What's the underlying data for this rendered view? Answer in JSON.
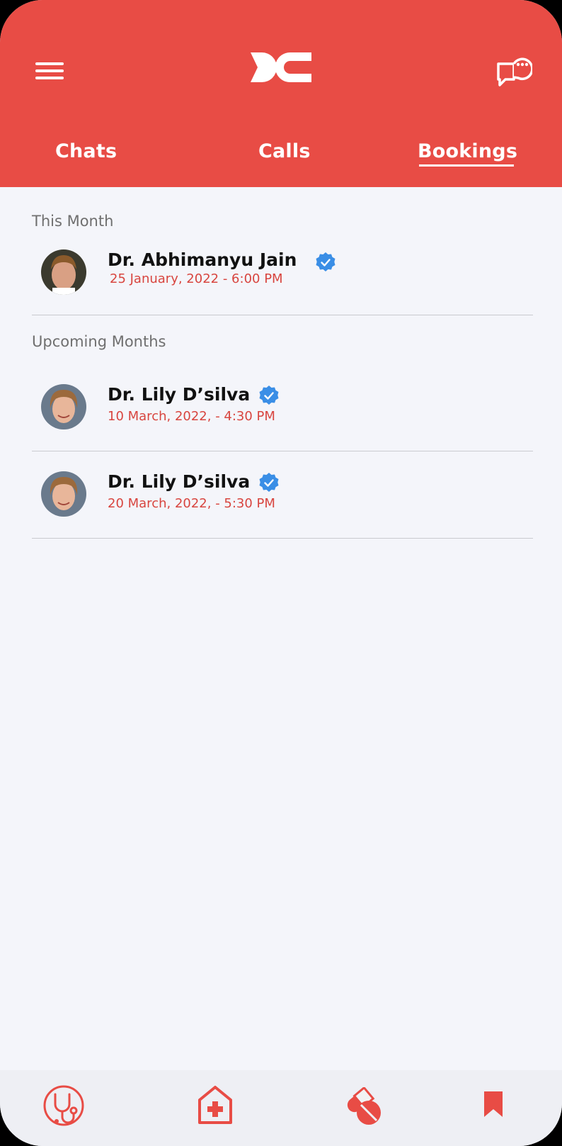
{
  "header": {
    "tabs": [
      {
        "label": "Chats",
        "active": false
      },
      {
        "label": "Calls",
        "active": false
      },
      {
        "label": "Bookings",
        "active": true
      }
    ]
  },
  "sections": [
    {
      "label": "This Month",
      "bookings": [
        {
          "name": "Dr. Abhimanyu Jain",
          "datetime": "25 January, 2022 - 6:00 PM",
          "verified": true
        }
      ]
    },
    {
      "label": "Upcoming Months",
      "bookings": [
        {
          "name": "Dr. Lily D’silva",
          "datetime": "10 March, 2022, - 4:30 PM",
          "verified": true
        },
        {
          "name": "Dr. Lily D’silva",
          "datetime": "20 March, 2022, - 5:30 PM",
          "verified": true
        }
      ]
    }
  ],
  "bottom_nav": {
    "items": [
      "stethoscope-icon",
      "hospital-icon",
      "pills-icon",
      "bookmark-icon"
    ]
  },
  "colors": {
    "accent": "#e84c45",
    "verified": "#3a8ee6",
    "background": "#f4f5fa"
  }
}
